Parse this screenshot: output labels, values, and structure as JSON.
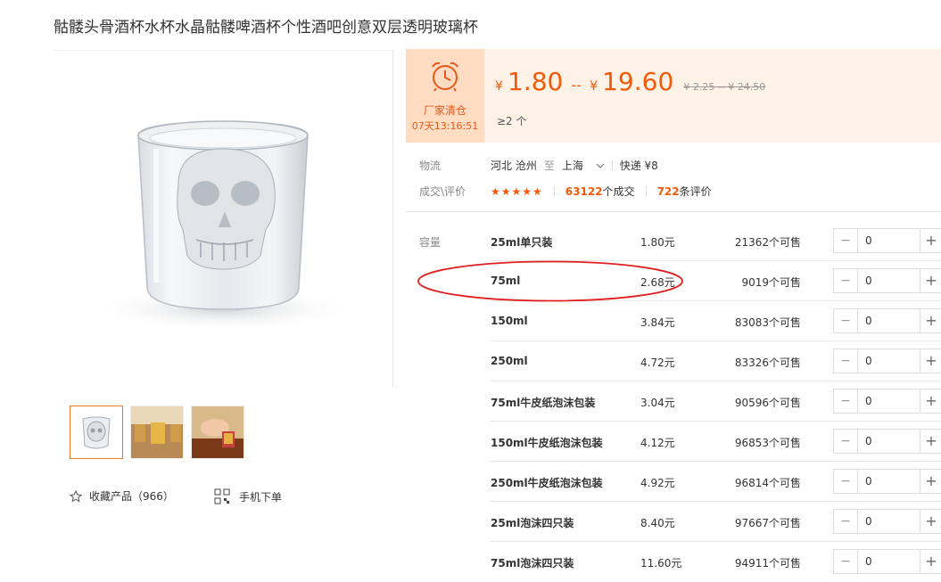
{
  "product": {
    "title": "骷髅头骨酒杯水杯水晶骷髅啤酒杯个性酒吧创意双层透明玻璃杯"
  },
  "gallery": {
    "thumbnails": [
      "skull-glass-thumb-1",
      "skull-glass-thumb-2",
      "skull-glass-thumb-3"
    ]
  },
  "actions": {
    "favorite": "收藏产品（966）",
    "mobile_order": "手机下单"
  },
  "price": {
    "promo_label": "厂家清仓",
    "countdown": "07天13:16:51",
    "currency": "¥",
    "low": "1.80",
    "range_sep": "--",
    "high": "19.60",
    "original": "¥ 2.25 -- ¥ 24.50",
    "min_qty": "≥2 个"
  },
  "shipping": {
    "label": "物流",
    "from": "河北 沧州",
    "to_word": "至",
    "to": "上海",
    "express": "快递 ¥8"
  },
  "rating": {
    "label": "成交\\评价",
    "stars": "★★★★★",
    "deals_count": "63122",
    "deals_unit": "个成交",
    "reviews_count": "722",
    "reviews_unit": "条评价"
  },
  "variants": {
    "label": "容量",
    "items": [
      {
        "name": "25ml单只装",
        "price": "1.80元",
        "stock": "21362个可售",
        "qty": "0"
      },
      {
        "name": "75ml",
        "price": "2.68元",
        "stock": "9019个可售",
        "qty": "0"
      },
      {
        "name": "150ml",
        "price": "3.84元",
        "stock": "83083个可售",
        "qty": "0"
      },
      {
        "name": "250ml",
        "price": "4.72元",
        "stock": "83326个可售",
        "qty": "0"
      },
      {
        "name": "75ml牛皮纸泡沫包装",
        "price": "3.04元",
        "stock": "90596个可售",
        "qty": "0"
      },
      {
        "name": "150ml牛皮纸泡沫包装",
        "price": "4.12元",
        "stock": "96853个可售",
        "qty": "0"
      },
      {
        "name": "250ml牛皮纸泡沫包装",
        "price": "4.92元",
        "stock": "96814个可售",
        "qty": "0"
      },
      {
        "name": "25ml泡沫四只装",
        "price": "8.40元",
        "stock": "97667个可售",
        "qty": "0"
      },
      {
        "name": "75ml泡沫四只装",
        "price": "11.60元",
        "stock": "94911个可售",
        "qty": "0"
      }
    ]
  },
  "colors": {
    "accent": "#f25a0a",
    "promo_bg": "#ffdcc2",
    "price_bg": "#fff2e6",
    "annotation": "#e02020"
  }
}
